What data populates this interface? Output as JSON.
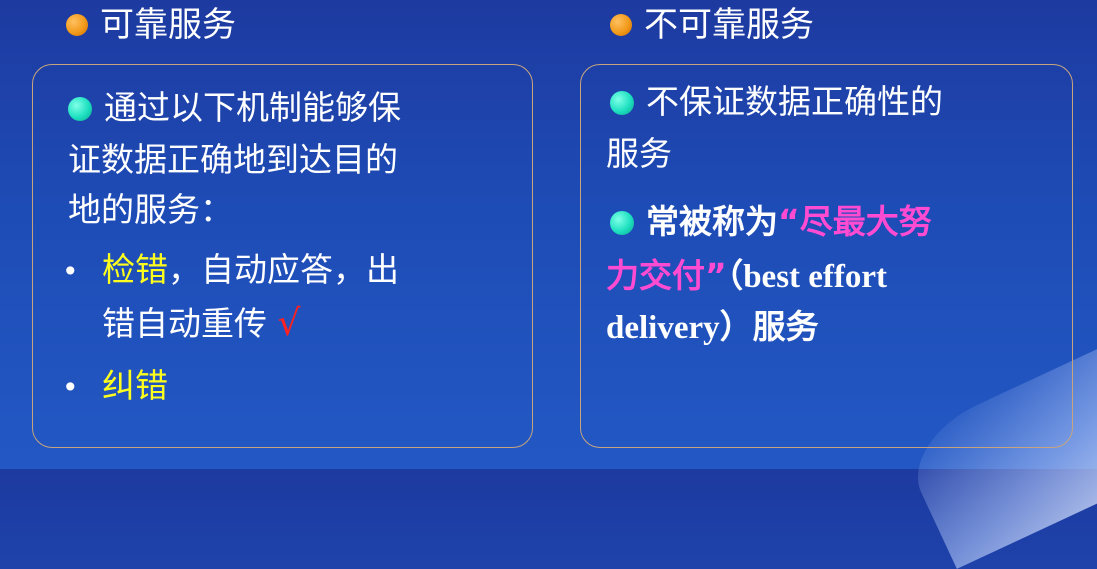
{
  "left": {
    "heading": "可靠服务",
    "desc_line1": "通过以下机制能够保",
    "desc_line2": "证数据正确地到达目的",
    "desc_line3": "地的服务：",
    "b1_yellow": "检错",
    "b1_white": "，自动应答，出",
    "b1_line2": "错自动重传",
    "b1_mark": "√",
    "b2_yellow": "纠错"
  },
  "right": {
    "heading": "不可靠服务",
    "p1_line1": "不保证数据正确性的",
    "p1_line2": "服务",
    "p2_bold": "常被称为",
    "p2_pink1": "“尽最大努",
    "p2_pink2": "力交付”",
    "p2_rest1": "（best effort",
    "p2_rest2": "delivery）服务"
  },
  "colors": {
    "background": "#1e4cb6",
    "heading_dot": "#f29a1a",
    "text_dot": "#1de0c0",
    "highlight": "#ffff1e",
    "pink": "#ff4ad2",
    "check": "#ff2020",
    "panel_border": "#c7a47e"
  },
  "icons": {
    "heading_bullet": "orange-circle",
    "text_bullet": "teal-circle"
  }
}
